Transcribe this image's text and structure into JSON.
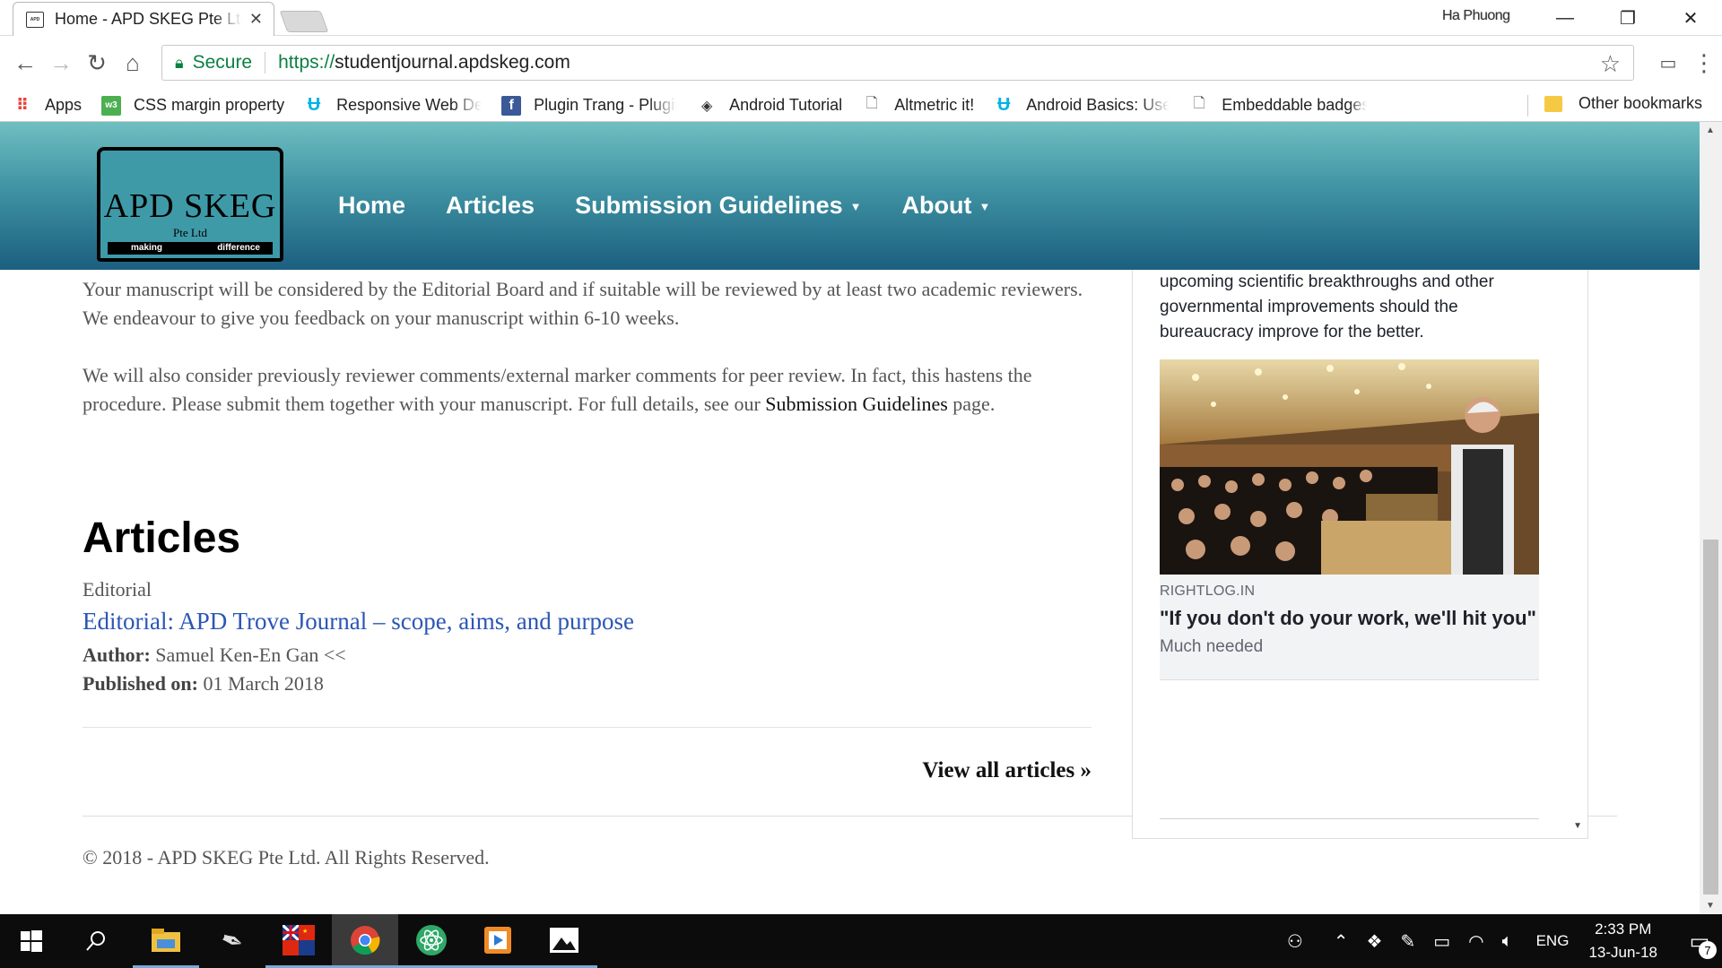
{
  "browser": {
    "tab_title": "Home - APD SKEG Pte Ltd",
    "user_name": "Ha Phuong",
    "secure_label": "Secure",
    "url_scheme": "https://",
    "url_host": "studentjournal.apdskeg.com",
    "bookmarks": [
      {
        "label": "Apps",
        "icon": "apps-grid-icon"
      },
      {
        "label": "CSS margin property",
        "icon": "w3-icon"
      },
      {
        "label": "Responsive Web Design",
        "icon": "udacity-icon"
      },
      {
        "label": "Plugin Trang - Plugin",
        "icon": "facebook-icon"
      },
      {
        "label": "Android Tutorial",
        "icon": "android-tutorial-icon"
      },
      {
        "label": "Altmetric it!",
        "icon": "page-icon"
      },
      {
        "label": "Android Basics: User",
        "icon": "udacity-icon"
      },
      {
        "label": "Embeddable badges",
        "icon": "page-icon"
      }
    ],
    "other_bookmarks": "Other bookmarks"
  },
  "site": {
    "logo_name": "APD SKEG",
    "logo_sub": "Pte Ltd",
    "logo_tag_left": "making",
    "logo_tag_right": "difference",
    "nav": {
      "home": "Home",
      "articles": "Articles",
      "submission": "Submission Guidelines",
      "about": "About"
    }
  },
  "main": {
    "para1": "Your manuscript will be considered by the Editorial Board and if suitable will be reviewed by at least two academic reviewers. We endeavour to give you feedback on your manuscript within 6-10 weeks.",
    "para2_start": "We will also consider previously reviewer comments/external marker comments for peer review. In fact, this hastens the procedure. Please submit them together with your manuscript. For full details, see our ",
    "para2_link": "Submission Guidelines",
    "para2_end": " page.",
    "articles_heading": "Articles",
    "article": {
      "category": "Editorial",
      "title": "Editorial: APD Trove Journal – scope, aims, and purpose",
      "author_label": "Author:",
      "author": "Samuel Ken-En Gan <<",
      "published_label": "Published on:",
      "published": "01 March 2018"
    },
    "view_all": "View all articles »",
    "footer": "© 2018 - APD SKEG Pte Ltd. All Rights Reserved."
  },
  "sidebar": {
    "post_text": "upcoming scientific breakthroughs and other governmental improvements should the bureaucracy improve for the better.",
    "link_source": "RIGHTLOG.IN",
    "link_title": "\"If you don't do your work, we'll hit you\"",
    "link_desc": "Much needed"
  },
  "taskbar": {
    "language": "ENG",
    "time": "2:33 PM",
    "date": "13-Jun-18",
    "notification_count": "7"
  },
  "colors": {
    "header_top": "#6fbfc1",
    "header_bottom": "#1c5f80",
    "link_blue": "#2b56b5",
    "secure_green": "#0b8043"
  }
}
